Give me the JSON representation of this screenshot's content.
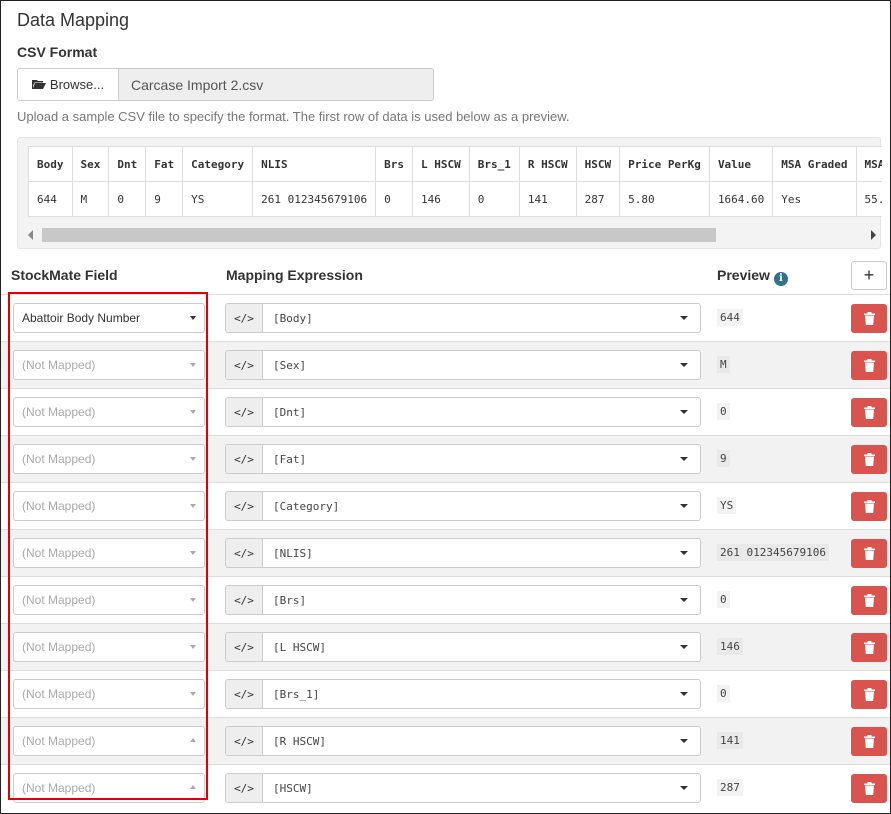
{
  "title": "Data Mapping",
  "csv_format_label": "CSV Format",
  "browse_label": "Browse...",
  "file_name": "Carcase Import 2.csv",
  "help_text": "Upload a sample CSV file to specify the format. The first row of data is used below as a preview.",
  "preview_table": {
    "headers": [
      "Body",
      "Sex",
      "Dnt",
      "Fat",
      "Category",
      "NLIS",
      "Brs",
      "L HSCW",
      "Brs_1",
      "R HSCW",
      "HSCW",
      "Price PerKg",
      "Value",
      "MSA Graded",
      "MSA"
    ],
    "row": [
      "644",
      "M",
      "0",
      "9",
      "YS",
      "261 012345679106",
      "0",
      "146",
      "0",
      "141",
      "287",
      "5.80",
      "1664.60",
      "Yes",
      "55."
    ]
  },
  "columns": {
    "field": "StockMate Field",
    "expression": "Mapping Expression",
    "preview": "Preview"
  },
  "add_label": "+",
  "code_label": "</>",
  "mappings": [
    {
      "field": "Abattoir Body Number",
      "expr": "[Body]",
      "preview": "644"
    },
    {
      "field": "(Not Mapped)",
      "expr": "[Sex]",
      "preview": "M"
    },
    {
      "field": "(Not Mapped)",
      "expr": "[Dnt]",
      "preview": "0"
    },
    {
      "field": "(Not Mapped)",
      "expr": "[Fat]",
      "preview": "9"
    },
    {
      "field": "(Not Mapped)",
      "expr": "[Category]",
      "preview": "YS"
    },
    {
      "field": "(Not Mapped)",
      "expr": "[NLIS]",
      "preview": "261 012345679106"
    },
    {
      "field": "(Not Mapped)",
      "expr": "[Brs]",
      "preview": "0"
    },
    {
      "field": "(Not Mapped)",
      "expr": "[L HSCW]",
      "preview": "146"
    },
    {
      "field": "(Not Mapped)",
      "expr": "[Brs_1]",
      "preview": "0"
    },
    {
      "field": "(Not Mapped)",
      "expr": "[R HSCW]",
      "preview": "141"
    },
    {
      "field": "(Not Mapped)",
      "expr": "[HSCW]",
      "preview": "287"
    }
  ]
}
